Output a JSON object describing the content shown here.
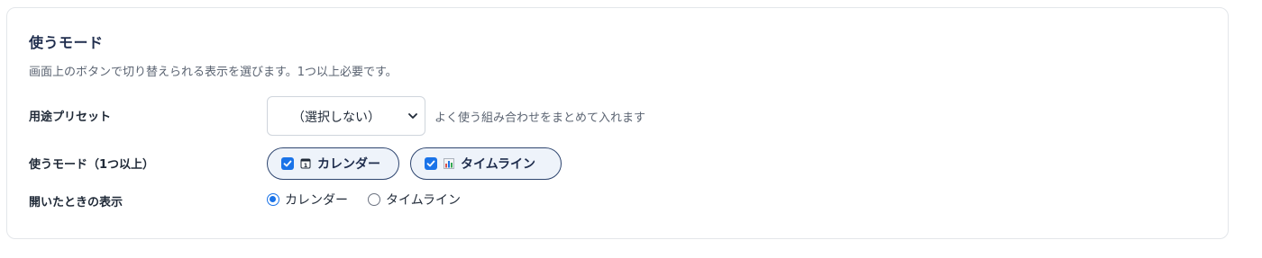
{
  "section": {
    "title": "使うモード",
    "description": "画面上のボタンで切り替えられる表示を選びます。1つ以上必要です。"
  },
  "preset": {
    "label": "用途プリセット",
    "selected": "（選択しない）",
    "hint": "よく使う組み合わせをまとめて入れます"
  },
  "modes": {
    "label": "使うモード（1つ以上）",
    "options": [
      {
        "label": "カレンダー",
        "checked": true,
        "icon": "calendar-icon"
      },
      {
        "label": "タイムライン",
        "checked": true,
        "icon": "bar-chart-icon"
      }
    ]
  },
  "default_view": {
    "label": "開いたときの表示",
    "options": [
      {
        "label": "カレンダー",
        "selected": true
      },
      {
        "label": "タイムライン",
        "selected": false
      }
    ]
  },
  "colors": {
    "accent": "#1a73e8",
    "pill_border": "#2f4670",
    "pill_bg": "#eef3fa"
  }
}
